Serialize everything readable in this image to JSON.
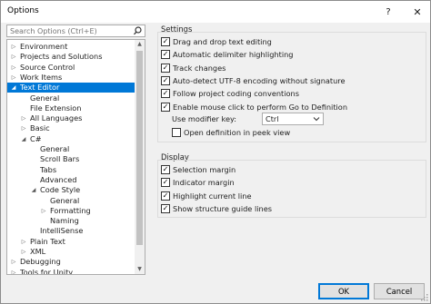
{
  "window": {
    "title": "Options"
  },
  "titlebar": {
    "help_icon": "?",
    "close_icon": "✕"
  },
  "search": {
    "placeholder": "Search Options (Ctrl+E)"
  },
  "tree": {
    "items": [
      {
        "label": "Environment",
        "indent": 0,
        "expander": "collapsed",
        "selected": false
      },
      {
        "label": "Projects and Solutions",
        "indent": 0,
        "expander": "collapsed",
        "selected": false
      },
      {
        "label": "Source Control",
        "indent": 0,
        "expander": "collapsed",
        "selected": false
      },
      {
        "label": "Work Items",
        "indent": 0,
        "expander": "collapsed",
        "selected": false
      },
      {
        "label": "Text Editor",
        "indent": 0,
        "expander": "expanded",
        "selected": true
      },
      {
        "label": "General",
        "indent": 1,
        "expander": "none",
        "selected": false
      },
      {
        "label": "File Extension",
        "indent": 1,
        "expander": "none",
        "selected": false
      },
      {
        "label": "All Languages",
        "indent": 1,
        "expander": "collapsed",
        "selected": false
      },
      {
        "label": "Basic",
        "indent": 1,
        "expander": "collapsed",
        "selected": false
      },
      {
        "label": "C#",
        "indent": 1,
        "expander": "expanded",
        "selected": false
      },
      {
        "label": "General",
        "indent": 2,
        "expander": "none",
        "selected": false
      },
      {
        "label": "Scroll Bars",
        "indent": 2,
        "expander": "none",
        "selected": false
      },
      {
        "label": "Tabs",
        "indent": 2,
        "expander": "none",
        "selected": false
      },
      {
        "label": "Advanced",
        "indent": 2,
        "expander": "none",
        "selected": false
      },
      {
        "label": "Code Style",
        "indent": 2,
        "expander": "expanded",
        "selected": false
      },
      {
        "label": "General",
        "indent": 3,
        "expander": "none",
        "selected": false
      },
      {
        "label": "Formatting",
        "indent": 3,
        "expander": "collapsed",
        "selected": false
      },
      {
        "label": "Naming",
        "indent": 3,
        "expander": "none",
        "selected": false
      },
      {
        "label": "IntelliSense",
        "indent": 2,
        "expander": "none",
        "selected": false
      },
      {
        "label": "Plain Text",
        "indent": 1,
        "expander": "collapsed",
        "selected": false
      },
      {
        "label": "XML",
        "indent": 1,
        "expander": "collapsed",
        "selected": false
      },
      {
        "label": "Debugging",
        "indent": 0,
        "expander": "collapsed",
        "selected": false
      },
      {
        "label": "Tools for Unity",
        "indent": 0,
        "expander": "collapsed",
        "selected": false
      }
    ]
  },
  "settings": {
    "title": "Settings",
    "options": [
      {
        "label": "Drag and drop text editing",
        "checked": true
      },
      {
        "label": "Automatic delimiter highlighting",
        "checked": true
      },
      {
        "label": "Track changes",
        "checked": true
      },
      {
        "label": "Auto-detect UTF-8 encoding without signature",
        "checked": true
      },
      {
        "label": "Follow project coding conventions",
        "checked": true
      },
      {
        "label": "Enable mouse click to perform Go to Definition",
        "checked": true
      }
    ],
    "modifier_key_label": "Use modifier key:",
    "modifier_key_value": "Ctrl",
    "peek_option": {
      "label": "Open definition in peek view",
      "checked": false
    }
  },
  "display": {
    "title": "Display",
    "options": [
      {
        "label": "Selection margin",
        "checked": true
      },
      {
        "label": "Indicator margin",
        "checked": true
      },
      {
        "label": "Highlight current line",
        "checked": true
      },
      {
        "label": "Show structure guide lines",
        "checked": true
      }
    ]
  },
  "footer": {
    "ok_label": "OK",
    "cancel_label": "Cancel"
  },
  "colors": {
    "selection": "#0078d7",
    "background": "#f0f0f0"
  }
}
